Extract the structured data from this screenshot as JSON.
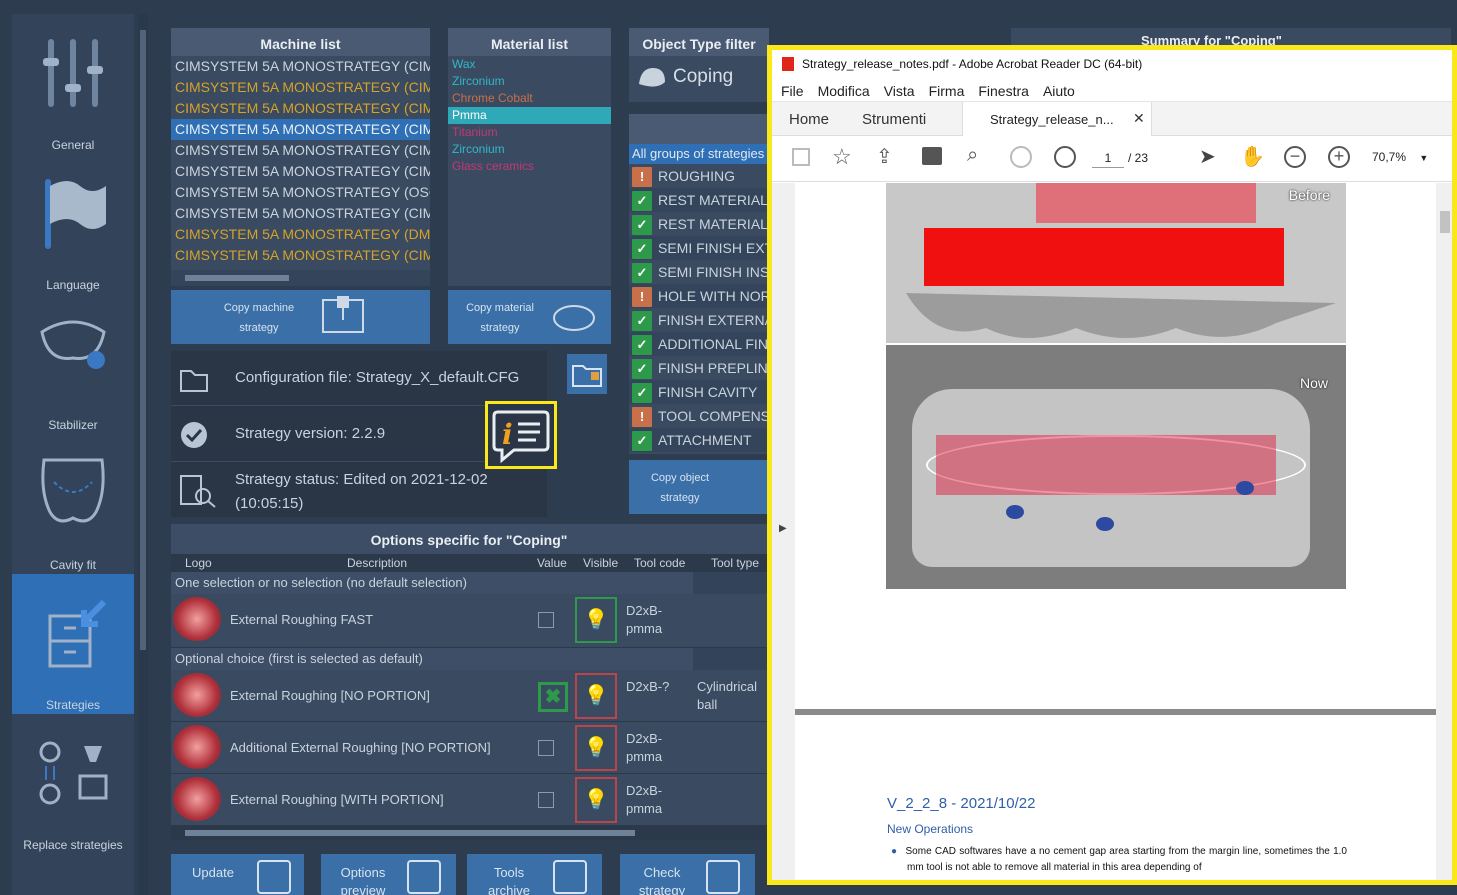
{
  "sidebar": {
    "items": [
      {
        "label": "General",
        "icon": "sliders-icon"
      },
      {
        "label": "Language",
        "icon": "flag-icon"
      },
      {
        "label": "Stabilizer",
        "icon": "stabilizer-icon"
      },
      {
        "label": "Cavity fit",
        "icon": "cavity-icon"
      },
      {
        "label": "Strategies",
        "icon": "strategies-icon"
      },
      {
        "label": "Replace strategies",
        "icon": "replace-icon"
      }
    ]
  },
  "machine_list": {
    "title": "Machine list",
    "items": [
      "CIMSYSTEM 5A MONOSTRATEGY (CIM",
      "CIMSYSTEM 5A MONOSTRATEGY (CIM",
      "CIMSYSTEM 5A MONOSTRATEGY (CIM",
      "CIMSYSTEM 5A MONOSTRATEGY (CIM",
      "CIMSYSTEM 5A MONOSTRATEGY (CIM",
      "CIMSYSTEM 5A MONOSTRATEGY (CIM",
      "CIMSYSTEM 5A MONOSTRATEGY (OSC",
      "CIMSYSTEM 5A MONOSTRATEGY (CIM",
      "CIMSYSTEM 5A MONOSTRATEGY (DM",
      "CIMSYSTEM 5A MONOSTRATEGY (CIM",
      "CIMSYSTEM 5A MONOSTRATEGY (DM"
    ],
    "copy_btn": "Copy machine strategy"
  },
  "material_list": {
    "title": "Material list",
    "items": [
      "Wax",
      "Zirconium",
      "Chrome Cobalt",
      "Pmma",
      "Titanium",
      "Zirconium",
      "Glass ceramics"
    ],
    "copy_btn": "Copy material strategy"
  },
  "object_type": {
    "title": "Object Type filter",
    "value": "Coping"
  },
  "summary": {
    "title": "Summary for \"Coping\""
  },
  "groups": {
    "header": "All groups of strategies",
    "items": [
      "ROUGHING",
      "REST MATERIAL E",
      "REST MATERIAL IN",
      "SEMI FINISH EXTE",
      "SEMI FINISH INSI",
      "HOLE WITH NORI",
      "FINISH EXTERNAL",
      "ADDITIONAL FINI",
      "FINISH PREPLINE",
      "FINISH CAVITY",
      "TOOL COMPENSA",
      "ATTACHMENT"
    ],
    "status": [
      "warn",
      "ok",
      "ok",
      "ok",
      "ok",
      "warn",
      "ok",
      "ok",
      "ok",
      "ok",
      "warn",
      "ok"
    ],
    "copy_btn": "Copy object strategy"
  },
  "config": {
    "file": "Configuration file: Strategy_X_default.CFG",
    "version": "Strategy version: 2.2.9",
    "status": "Strategy status: Edited on 2021-12-02 (10:05:15)"
  },
  "options": {
    "title": "Options specific for \"Coping\"",
    "cols": [
      "Logo",
      "Description",
      "Value",
      "Visible",
      "Tool code",
      "Tool type"
    ],
    "section1": "One selection or no selection (no default selection)",
    "section2": "Optional choice (first is selected as default)",
    "rows": [
      {
        "desc": "External Roughing FAST",
        "code": "D2xB-pmma",
        "type": ""
      },
      {
        "desc": "External Roughing  [NO PORTION]",
        "code": "D2xB-?",
        "type": "Cylindrical ball"
      },
      {
        "desc": "Additional External Roughing  [NO PORTION]",
        "code": "D2xB-pmma",
        "type": ""
      },
      {
        "desc": "External Roughing  [WITH PORTION]",
        "code": "D2xB-pmma",
        "type": ""
      }
    ]
  },
  "bottom_buttons": [
    "Update",
    "Options preview",
    "Tools archive",
    "Check strategy"
  ],
  "acrobat": {
    "title": "Strategy_release_notes.pdf - Adobe Acrobat Reader DC (64-bit)",
    "menu": [
      "File",
      "Modifica",
      "Vista",
      "Firma",
      "Finestra",
      "Aiuto"
    ],
    "tabs": [
      "Home",
      "Strumenti",
      "Strategy_release_n..."
    ],
    "page": "1",
    "pages": "/ 23",
    "zoom": "70,7%",
    "before": "Before",
    "now": "Now",
    "heading": "V_2_2_8 - 2021/10/22",
    "subheading": "New Operations",
    "bullet": "Some CAD softwares have a no cement gap area starting from the margin line, sometimes the 1.0 mm tool is not able to remove all material in this area depending of"
  }
}
